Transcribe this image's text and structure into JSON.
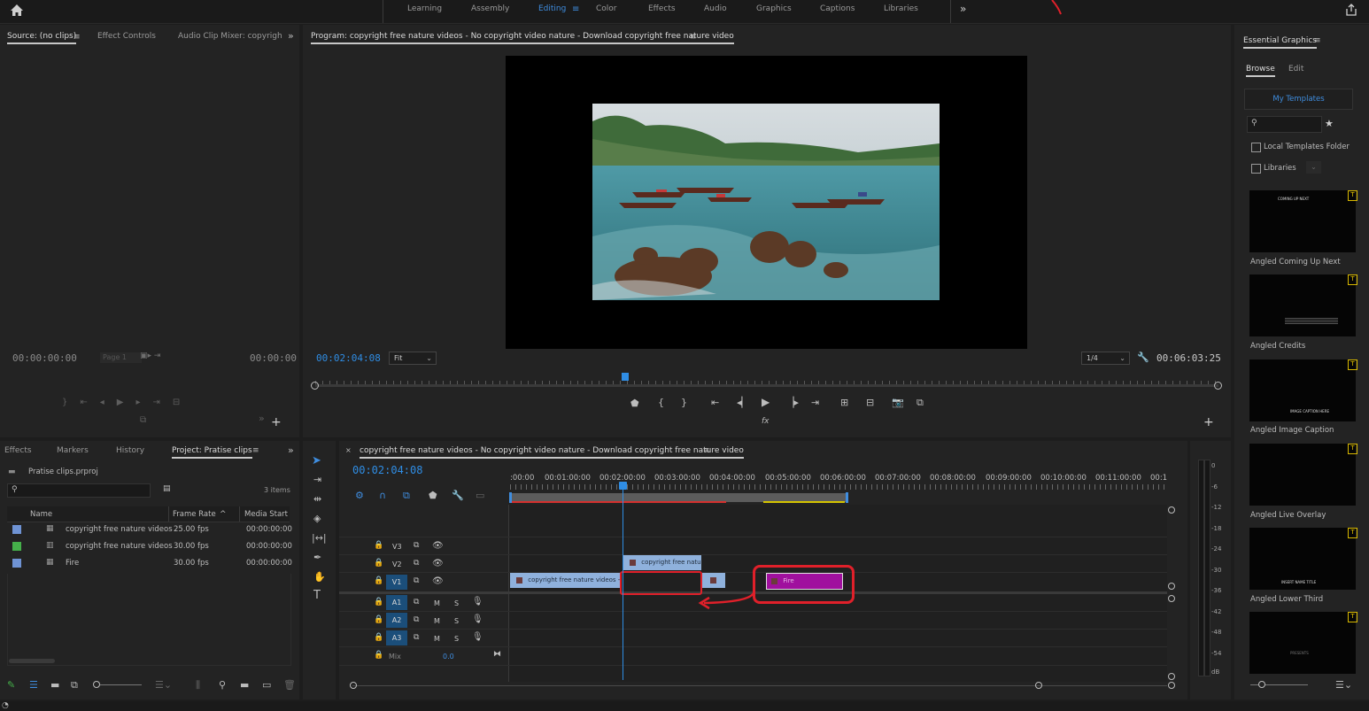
{
  "workspaces": {
    "items": [
      "Learning",
      "Assembly",
      "Editing",
      "Color",
      "Effects",
      "Audio",
      "Graphics",
      "Captions",
      "Libraries"
    ],
    "active": "Editing"
  },
  "source_panel": {
    "tabs": [
      "Source: (no clips)",
      "Effect Controls",
      "Audio Clip Mixer: copyrigh"
    ],
    "timecode_left": "00:00:00:00",
    "page": "Page 1",
    "timecode_right": "00:00:00"
  },
  "program_panel": {
    "title": "Program: copyright free nature videos - No copyright video nature - Download copyright free nature video",
    "timecode": "00:02:04:08",
    "fit": "Fit",
    "resolution": "1/4",
    "duration": "00:06:03:25",
    "playhead_fraction": 0.343
  },
  "project_panel": {
    "tabs": [
      "Effects",
      "Markers",
      "History",
      "Project: Pratise clips"
    ],
    "project_file": "Pratise clips.prproj",
    "item_count": "3 items",
    "columns": [
      "Name",
      "Frame Rate",
      "Media Start"
    ],
    "rows": [
      {
        "name": "copyright free nature videos",
        "rate": "25.00 fps",
        "start": "00:00:00:00",
        "color": "#6f93d4"
      },
      {
        "name": "copyright free nature videos",
        "rate": "30.00 fps",
        "start": "00:00:00:00",
        "color": "#45b04a"
      },
      {
        "name": "Fire",
        "rate": "30.00 fps",
        "start": "00:00:00:00",
        "color": "#6f93d4"
      }
    ]
  },
  "timeline": {
    "title": "copyright free nature videos - No copyright video nature - Download copyright free nature video",
    "timecode": "00:02:04:08",
    "ruler": [
      ":00:00",
      "00:01:00:00",
      "00:02:00:00",
      "00:03:00:00",
      "00:04:00:00",
      "00:05:00:00",
      "00:06:00:00",
      "00:07:00:00",
      "00:08:00:00",
      "00:09:00:00",
      "00:10:00:00",
      "00:11:00:00",
      "00:1"
    ],
    "tracks": {
      "v3": "V3",
      "v2": "V2",
      "v1": "V1",
      "a1": "A1",
      "a2": "A2",
      "a3": "A3",
      "mix": "Mix",
      "mix_value": "0.0",
      "m": "M",
      "s": "S"
    },
    "clips": {
      "v2_clip": "copyright free natur",
      "v1_clip": "copyright free nature videos - N",
      "fire_clip": "Fire"
    }
  },
  "audio_meter": {
    "labels": [
      "0",
      "-6",
      "-12",
      "-18",
      "-24",
      "-30",
      "-36",
      "-42",
      "-48",
      "-54",
      "dB"
    ]
  },
  "essential_graphics": {
    "title": "Essential Graphics",
    "tabs": [
      "Browse",
      "Edit"
    ],
    "my_templates": "My Templates",
    "local_templates": "Local Templates Folder",
    "libraries": "Libraries",
    "badge": "T",
    "templates": [
      {
        "label": "Angled Coming Up Next",
        "thumb_text": "COMING UP NEXT"
      },
      {
        "label": "Angled Credits",
        "thumb_text": ""
      },
      {
        "label": "Angled Image Caption",
        "thumb_text": "IMAGE CAPTION HERE"
      },
      {
        "label": "Angled Live Overlay",
        "thumb_text": ""
      },
      {
        "label": "Angled Lower Third",
        "thumb_text": "INSERT NAME TITLE"
      },
      {
        "label": "",
        "thumb_text": "PRESENTS"
      }
    ]
  },
  "colors": {
    "accent_blue": "#2f8de4",
    "annotation_red": "#e0202a",
    "clip_blue": "#8fb1dc",
    "fire_magenta": "#a0109e",
    "work_area_yellow": "#d4c400",
    "track_blue": "#1b4e7a"
  }
}
